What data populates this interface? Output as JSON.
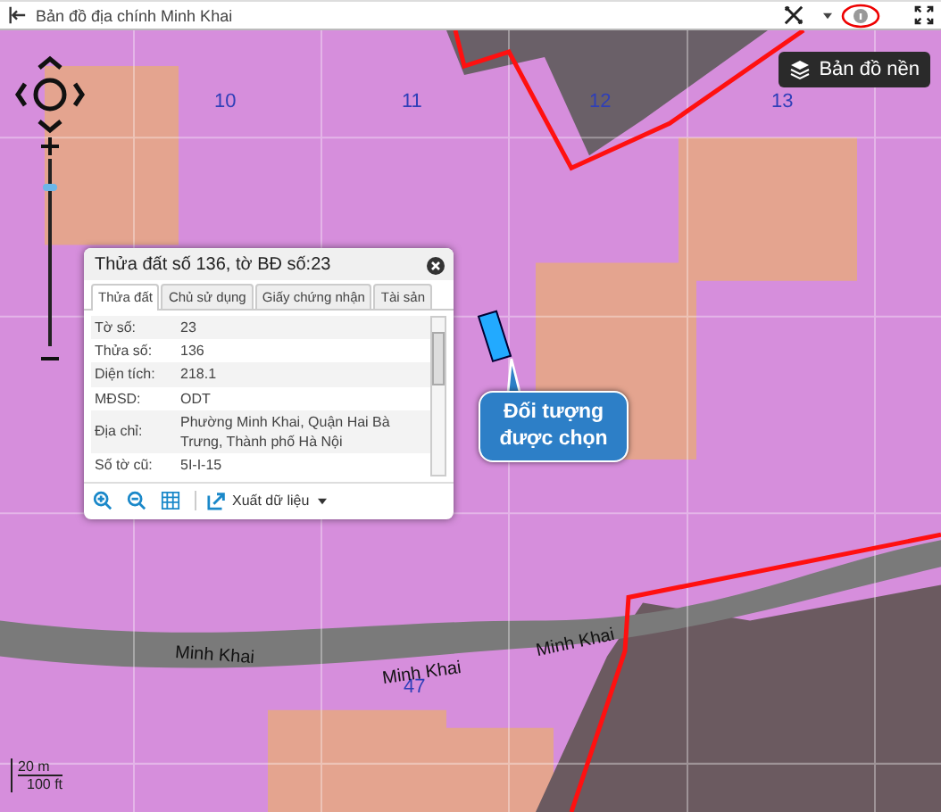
{
  "window": {
    "title": "Bản đồ địa chính Minh Khai"
  },
  "basemap_button": {
    "label": "Bản đồ nền"
  },
  "zoom_slider": {
    "level": 0.85
  },
  "map_labels": [
    {
      "text": "10",
      "kind": "sheet"
    },
    {
      "text": "11",
      "kind": "sheet"
    },
    {
      "text": "12",
      "kind": "sheet"
    },
    {
      "text": "13",
      "kind": "sheet"
    },
    {
      "text": "47",
      "kind": "sheet"
    },
    {
      "text": "Minh Khai",
      "kind": "road"
    },
    {
      "text": "Minh Khai",
      "kind": "road"
    },
    {
      "text": "Minh Khai",
      "kind": "road"
    }
  ],
  "scale": {
    "metric": "20 m",
    "imperial": "100 ft"
  },
  "callout": {
    "text": "Đối tượng được chọn"
  },
  "popup": {
    "title": "Thửa đất số 136, tờ BĐ số:23",
    "tabs": [
      {
        "label": "Thửa đất",
        "selected": true
      },
      {
        "label": "Chủ sử dụng",
        "selected": false
      },
      {
        "label": "Giấy chứng nhận",
        "selected": false
      },
      {
        "label": "Tài sản",
        "selected": false
      }
    ],
    "rows": [
      {
        "label": "Tờ số:",
        "value": "23"
      },
      {
        "label": "Thửa số:",
        "value": "136"
      },
      {
        "label": "Diện tích:",
        "value": "218.1"
      },
      {
        "label": "MĐSD:",
        "value": "ODT"
      },
      {
        "label": "Địa chỉ:",
        "value": "Phường Minh Khai, Quận Hai Bà Trưng, Thành phố Hà Nội"
      },
      {
        "label": "Số tờ cũ:",
        "value": "5I-I-15"
      }
    ],
    "export_button": {
      "label": "Xuất dữ liệu"
    }
  }
}
